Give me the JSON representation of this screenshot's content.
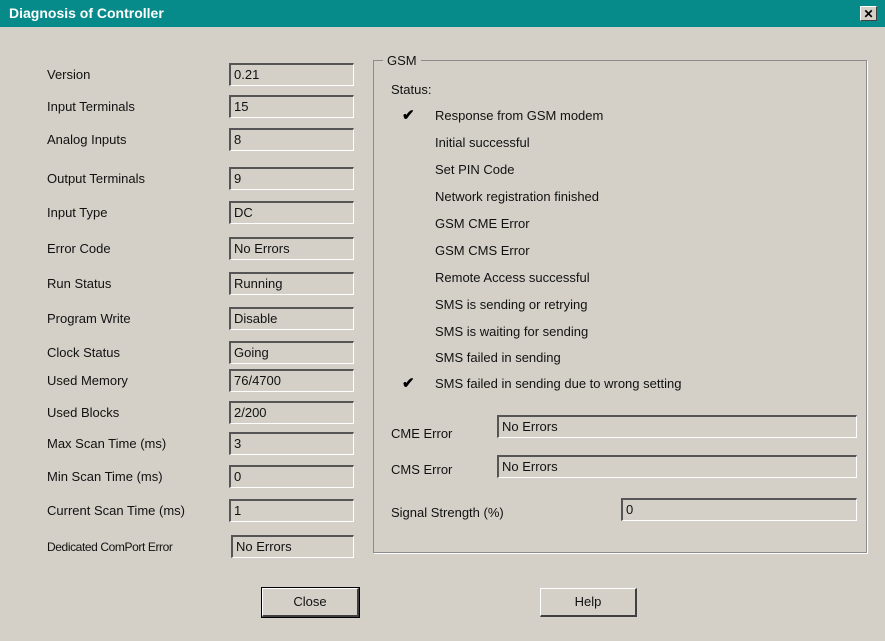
{
  "window": {
    "title": "Diagnosis of Controller",
    "close_glyph": "✕"
  },
  "left_panel": {
    "rows": [
      {
        "label": "Version",
        "value": "0.21"
      },
      {
        "label": "Input Terminals",
        "value": "15"
      },
      {
        "label": "Analog Inputs",
        "value": "8"
      },
      {
        "label": "Output Terminals",
        "value": "9"
      },
      {
        "label": "Input Type",
        "value": "DC"
      },
      {
        "label": "Error Code",
        "value": "No Errors"
      },
      {
        "label": "Run Status",
        "value": "Running"
      },
      {
        "label": "Program Write",
        "value": "Disable"
      },
      {
        "label": "Clock Status",
        "value": "Going"
      },
      {
        "label": "Used Memory",
        "value": "76/4700"
      },
      {
        "label": "Used Blocks",
        "value": "2/200"
      },
      {
        "label": "Max Scan Time (ms)",
        "value": "3"
      },
      {
        "label": "Min Scan Time (ms)",
        "value": "0"
      },
      {
        "label": "Current Scan Time (ms)",
        "value": "1"
      },
      {
        "label": "Dedicated ComPort Error",
        "value": "No Errors"
      }
    ]
  },
  "gsm": {
    "group_title": "GSM",
    "status_label": "Status:",
    "check_glyph": "✔",
    "status_items": [
      {
        "text": "Response from GSM modem",
        "checked": true
      },
      {
        "text": "Initial successful",
        "checked": false
      },
      {
        "text": "Set PIN Code",
        "checked": false
      },
      {
        "text": "Network registration finished",
        "checked": false
      },
      {
        "text": "GSM CME Error",
        "checked": false
      },
      {
        "text": "GSM CMS Error",
        "checked": false
      },
      {
        "text": "Remote Access successful",
        "checked": false
      },
      {
        "text": "SMS is sending or retrying",
        "checked": false
      },
      {
        "text": "SMS is waiting for sending",
        "checked": false
      },
      {
        "text": "SMS failed in sending",
        "checked": false
      },
      {
        "text": "SMS failed in sending due to wrong setting",
        "checked": true
      }
    ],
    "cme_error": {
      "label": "CME Error",
      "value": "No Errors"
    },
    "cms_error": {
      "label": "CMS Error",
      "value": "No Errors"
    },
    "signal_strength": {
      "label": "Signal Strength (%)",
      "value": "0"
    }
  },
  "buttons": {
    "close_label": "Close",
    "help_label": "Help"
  }
}
